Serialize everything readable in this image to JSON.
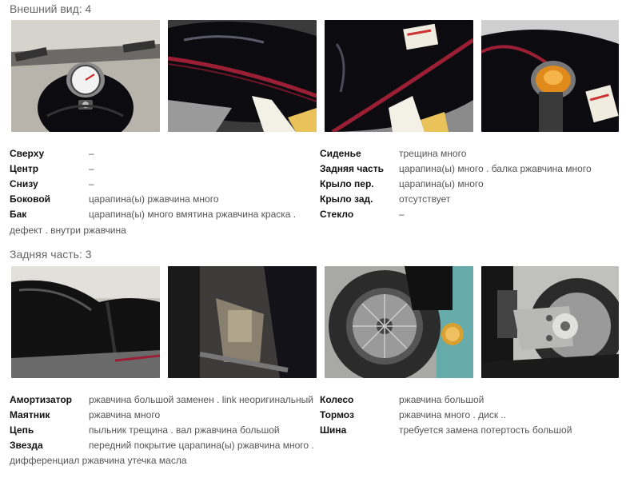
{
  "exterior": {
    "title": "Внешний вид: 4",
    "photos": [
      {
        "icon": "motorcycle-handlebar-photo"
      },
      {
        "icon": "fuel-tank-side-photo"
      },
      {
        "icon": "fuel-tank-scratch-photo"
      },
      {
        "icon": "fuel-filler-photo"
      }
    ],
    "left": [
      {
        "label": "Сверху",
        "value": "–"
      },
      {
        "label": "Центр",
        "value": "–"
      },
      {
        "label": "Снизу",
        "value": "–"
      },
      {
        "label": "Боковой",
        "value": "царапина(ы) ржавчина много"
      },
      {
        "label": "Бак",
        "value": "царапина(ы) много вмятина ржавчина краска ."
      }
    ],
    "left_continuation": "дефект . внутри ржавчина",
    "right": [
      {
        "label": "Сиденье",
        "value": "трещина много"
      },
      {
        "label": "Задняя часть",
        "value": "царапина(ы) много . балка ржавчина много"
      },
      {
        "label": "Крыло пер.",
        "value": "царапина(ы) много"
      },
      {
        "label": "Крыло зад.",
        "value": "отсутствует"
      },
      {
        "label": "Стекло",
        "value": "–"
      }
    ]
  },
  "rear": {
    "title": "Задняя часть: 3",
    "photos": [
      {
        "icon": "seat-photo"
      },
      {
        "icon": "swingarm-shock-photo"
      },
      {
        "icon": "rear-wheel-photo"
      },
      {
        "icon": "drive-shaft-photo"
      }
    ],
    "left": [
      {
        "label": "Амортизатор",
        "value": "ржавчина большой заменен . link неоригинальный"
      },
      {
        "label": "Маятник",
        "value": "ржавчина много"
      },
      {
        "label": "Цепь",
        "value": "пыльник трещина . вал ржавчина большой"
      },
      {
        "label": "Звезда",
        "value": "передний покрытие царапина(ы) ржавчина много ."
      }
    ],
    "left_continuation": "дифференциал ржавчина утечка масла",
    "right": [
      {
        "label": "Колесо",
        "value": "ржавчина большой"
      },
      {
        "label": "Тормоз",
        "value": "ржавчина много . диск .."
      },
      {
        "label": "Шина",
        "value": "требуется замена потертость большой"
      }
    ]
  },
  "colors": {
    "label": "#111111",
    "value": "#555555",
    "title": "#666666",
    "tank": "#0b0b10",
    "stripe": "#9a1f35"
  }
}
